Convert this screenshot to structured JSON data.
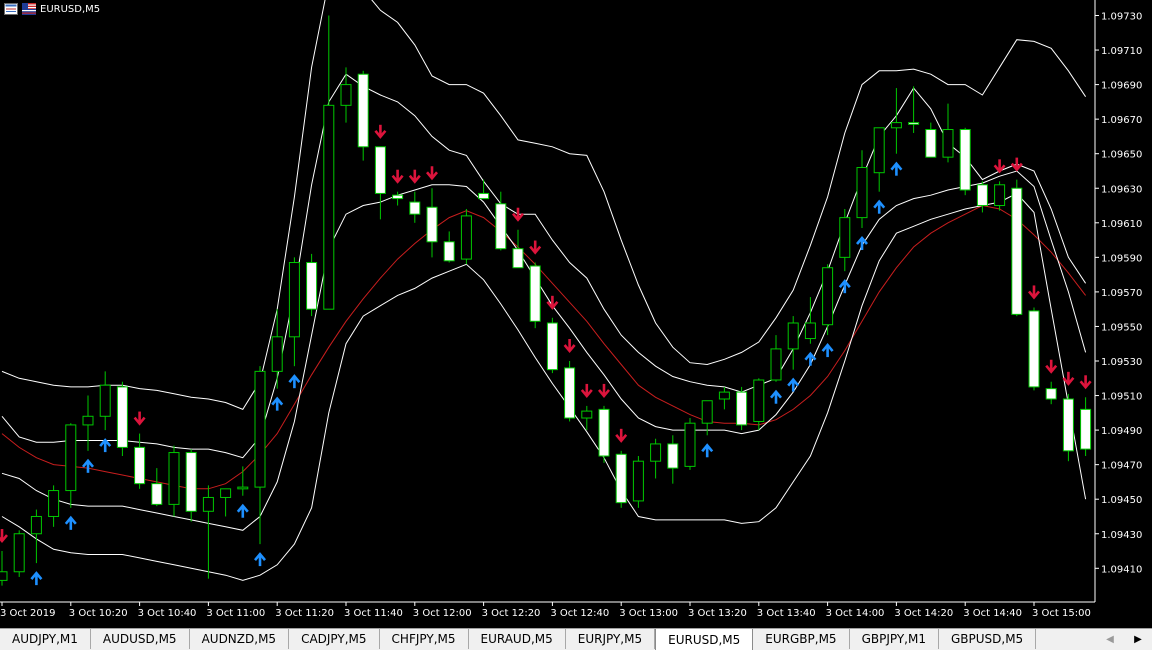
{
  "window": {
    "title": "EURUSD,M5"
  },
  "colors": {
    "background": "#000000",
    "bull_candle": "#00c800",
    "bear_candle_fill": "#ffffff",
    "bands": "#ffffff",
    "center_line": "#c81e1e",
    "up_arrow": "#1e90ff",
    "down_arrow": "#dc143c",
    "axis_text": "#ffffff"
  },
  "chart_data": {
    "type": "candlestick",
    "symbol": "EURUSD",
    "timeframe": "M5",
    "y_axis": {
      "labels": [
        "1.09730",
        "1.09710",
        "1.09690",
        "1.09670",
        "1.09650",
        "1.09630",
        "1.09610",
        "1.09590",
        "1.09570",
        "1.09550",
        "1.09530",
        "1.09510",
        "1.09490",
        "1.09470",
        "1.09450",
        "1.09430",
        "1.09410"
      ],
      "range": [
        1.09392,
        1.09742
      ]
    },
    "x_axis": {
      "labels": [
        "3 Oct 2019",
        "3 Oct 10:20",
        "3 Oct 10:40",
        "3 Oct 11:00",
        "3 Oct 11:20",
        "3 Oct 11:40",
        "3 Oct 12:00",
        "3 Oct 12:20",
        "3 Oct 12:40",
        "3 Oct 13:00",
        "3 Oct 13:20",
        "3 Oct 13:40",
        "3 Oct 14:00",
        "3 Oct 14:20",
        "3 Oct 14:40",
        "3 Oct 15:00"
      ]
    },
    "candles": [
      {
        "o": 1.09403,
        "h": 1.0942,
        "l": 1.094,
        "c": 1.09408
      },
      {
        "o": 1.09408,
        "h": 1.09432,
        "l": 1.09405,
        "c": 1.0943
      },
      {
        "o": 1.0943,
        "h": 1.09444,
        "l": 1.09413,
        "c": 1.0944
      },
      {
        "o": 1.0944,
        "h": 1.09458,
        "l": 1.09434,
        "c": 1.09455
      },
      {
        "o": 1.09455,
        "h": 1.09494,
        "l": 1.09445,
        "c": 1.09493
      },
      {
        "o": 1.09493,
        "h": 1.0951,
        "l": 1.09478,
        "c": 1.09498
      },
      {
        "o": 1.09498,
        "h": 1.09524,
        "l": 1.0949,
        "c": 1.09516
      },
      {
        "o": 1.09515,
        "h": 1.09518,
        "l": 1.09475,
        "c": 1.0948
      },
      {
        "o": 1.0948,
        "h": 1.09488,
        "l": 1.09456,
        "c": 1.09459
      },
      {
        "o": 1.09459,
        "h": 1.09468,
        "l": 1.09446,
        "c": 1.09447
      },
      {
        "o": 1.09447,
        "h": 1.09481,
        "l": 1.0944,
        "c": 1.09477
      },
      {
        "o": 1.09477,
        "h": 1.09479,
        "l": 1.09437,
        "c": 1.09443
      },
      {
        "o": 1.09443,
        "h": 1.09458,
        "l": 1.09404,
        "c": 1.09451
      },
      {
        "o": 1.09451,
        "h": 1.09455,
        "l": 1.0944,
        "c": 1.09456
      },
      {
        "o": 1.09456,
        "h": 1.09469,
        "l": 1.09452,
        "c": 1.09457
      },
      {
        "o": 1.09457,
        "h": 1.09527,
        "l": 1.09424,
        "c": 1.09524
      },
      {
        "o": 1.09524,
        "h": 1.0956,
        "l": 1.09514,
        "c": 1.09544
      },
      {
        "o": 1.09544,
        "h": 1.0959,
        "l": 1.09527,
        "c": 1.09587
      },
      {
        "o": 1.09587,
        "h": 1.09592,
        "l": 1.09556,
        "c": 1.0956
      },
      {
        "o": 1.0956,
        "h": 1.0973,
        "l": 1.0956,
        "c": 1.09678
      },
      {
        "o": 1.09678,
        "h": 1.097,
        "l": 1.09668,
        "c": 1.0969
      },
      {
        "o": 1.09696,
        "h": 1.09698,
        "l": 1.09646,
        "c": 1.09654
      },
      {
        "o": 1.09654,
        "h": 1.09654,
        "l": 1.09612,
        "c": 1.09627
      },
      {
        "o": 1.09626,
        "h": 1.09628,
        "l": 1.0962,
        "c": 1.09624
      },
      {
        "o": 1.09622,
        "h": 1.09628,
        "l": 1.0961,
        "c": 1.09615
      },
      {
        "o": 1.09619,
        "h": 1.0963,
        "l": 1.0959,
        "c": 1.09599
      },
      {
        "o": 1.09599,
        "h": 1.09605,
        "l": 1.09587,
        "c": 1.09588
      },
      {
        "o": 1.09589,
        "h": 1.09618,
        "l": 1.09586,
        "c": 1.09614
      },
      {
        "o": 1.09627,
        "h": 1.09635,
        "l": 1.09624,
        "c": 1.09624
      },
      {
        "o": 1.09621,
        "h": 1.09628,
        "l": 1.09594,
        "c": 1.09595
      },
      {
        "o": 1.09595,
        "h": 1.09606,
        "l": 1.09584,
        "c": 1.09584
      },
      {
        "o": 1.09585,
        "h": 1.09587,
        "l": 1.09549,
        "c": 1.09553
      },
      {
        "o": 1.09552,
        "h": 1.09555,
        "l": 1.09523,
        "c": 1.09525
      },
      {
        "o": 1.09526,
        "h": 1.0953,
        "l": 1.09495,
        "c": 1.09497
      },
      {
        "o": 1.09497,
        "h": 1.09504,
        "l": 1.0949,
        "c": 1.09501
      },
      {
        "o": 1.09502,
        "h": 1.09504,
        "l": 1.09471,
        "c": 1.09475
      },
      {
        "o": 1.09476,
        "h": 1.09478,
        "l": 1.09445,
        "c": 1.09448
      },
      {
        "o": 1.09449,
        "h": 1.09475,
        "l": 1.09445,
        "c": 1.09472
      },
      {
        "o": 1.09472,
        "h": 1.09485,
        "l": 1.09462,
        "c": 1.09482
      },
      {
        "o": 1.09482,
        "h": 1.09487,
        "l": 1.09459,
        "c": 1.09468
      },
      {
        "o": 1.09469,
        "h": 1.09497,
        "l": 1.09467,
        "c": 1.09494
      },
      {
        "o": 1.09494,
        "h": 1.09507,
        "l": 1.09487,
        "c": 1.09507
      },
      {
        "o": 1.09508,
        "h": 1.09515,
        "l": 1.09502,
        "c": 1.09512
      },
      {
        "o": 1.09512,
        "h": 1.09515,
        "l": 1.0949,
        "c": 1.09493
      },
      {
        "o": 1.09495,
        "h": 1.0952,
        "l": 1.0949,
        "c": 1.09519
      },
      {
        "o": 1.09519,
        "h": 1.09545,
        "l": 1.09518,
        "c": 1.09537
      },
      {
        "o": 1.09537,
        "h": 1.09556,
        "l": 1.09525,
        "c": 1.09552
      },
      {
        "o": 1.09543,
        "h": 1.09567,
        "l": 1.0954,
        "c": 1.09552
      },
      {
        "o": 1.09551,
        "h": 1.09586,
        "l": 1.09545,
        "c": 1.09584
      },
      {
        "o": 1.0959,
        "h": 1.09618,
        "l": 1.09582,
        "c": 1.09613
      },
      {
        "o": 1.09613,
        "h": 1.09652,
        "l": 1.09607,
        "c": 1.09642
      },
      {
        "o": 1.09639,
        "h": 1.09665,
        "l": 1.09628,
        "c": 1.09665
      },
      {
        "o": 1.09665,
        "h": 1.09688,
        "l": 1.0965,
        "c": 1.09668
      },
      {
        "o": 1.09668,
        "h": 1.09689,
        "l": 1.09662,
        "c": 1.09667
      },
      {
        "o": 1.09664,
        "h": 1.09668,
        "l": 1.09648,
        "c": 1.09648
      },
      {
        "o": 1.09648,
        "h": 1.09679,
        "l": 1.09645,
        "c": 1.09664
      },
      {
        "o": 1.09664,
        "h": 1.09665,
        "l": 1.09626,
        "c": 1.09629
      },
      {
        "o": 1.09632,
        "h": 1.09634,
        "l": 1.09616,
        "c": 1.0962
      },
      {
        "o": 1.0962,
        "h": 1.09634,
        "l": 1.09617,
        "c": 1.09632
      },
      {
        "o": 1.0963,
        "h": 1.09635,
        "l": 1.09556,
        "c": 1.09557
      },
      {
        "o": 1.09559,
        "h": 1.09561,
        "l": 1.09513,
        "c": 1.09515
      },
      {
        "o": 1.09514,
        "h": 1.09518,
        "l": 1.09505,
        "c": 1.09508
      },
      {
        "o": 1.09508,
        "h": 1.09511,
        "l": 1.09472,
        "c": 1.09478
      },
      {
        "o": 1.09502,
        "h": 1.09509,
        "l": 1.09475,
        "c": 1.09479
      }
    ],
    "indicators": {
      "upper_outer_band": [
        1.09524,
        1.0952,
        1.09518,
        1.09516,
        1.09515,
        1.09515,
        1.09516,
        1.09516,
        1.09514,
        1.09513,
        1.09511,
        1.09509,
        1.09508,
        1.09506,
        1.09502,
        1.09518,
        1.0956,
        1.09625,
        1.097,
        1.0975,
        1.0976,
        1.09745,
        1.09733,
        1.09726,
        1.09713,
        1.09695,
        1.0969,
        1.0969,
        1.09685,
        1.09672,
        1.09658,
        1.09656,
        1.09654,
        1.0965,
        1.09649,
        1.09628,
        1.096,
        1.09574,
        1.09552,
        1.09538,
        1.09529,
        1.09528,
        1.09531,
        1.09535,
        1.09541,
        1.09555,
        1.09571,
        1.09597,
        1.09625,
        1.09662,
        1.0969,
        1.09698,
        1.09698,
        1.09699,
        1.09696,
        1.0969,
        1.0969,
        1.09684,
        1.097,
        1.09716,
        1.09715,
        1.09711,
        1.09698,
        1.09683
      ],
      "upper_inner_band": [
        1.09498,
        1.09486,
        1.09483,
        1.09483,
        1.09484,
        1.09484,
        1.09484,
        1.09484,
        1.09483,
        1.09482,
        1.0948,
        1.09479,
        1.09479,
        1.09477,
        1.09474,
        1.09486,
        1.0952,
        1.0957,
        1.09632,
        1.0968,
        1.09696,
        1.09689,
        1.09684,
        1.0968,
        1.09672,
        1.0966,
        1.09652,
        1.09649,
        1.09634,
        1.09621,
        1.09615,
        1.09615,
        1.096,
        1.09587,
        1.09578,
        1.0956,
        1.09545,
        1.09535,
        1.09527,
        1.09521,
        1.09518,
        1.09516,
        1.09515,
        1.09512,
        1.09516,
        1.0952,
        1.09537,
        1.09558,
        1.09582,
        1.0961,
        1.09636,
        1.0966,
        1.09672,
        1.09688,
        1.09676,
        1.09656,
        1.09648,
        1.09635,
        1.0964,
        1.09644,
        1.0964,
        1.09618,
        1.0959,
        1.09575
      ],
      "center_line": [
        1.09488,
        1.0948,
        1.09474,
        1.0947,
        1.09469,
        1.09468,
        1.09466,
        1.09464,
        1.09462,
        1.0946,
        1.09458,
        1.09456,
        1.09456,
        1.09459,
        1.09466,
        1.09476,
        1.09488,
        1.09505,
        1.09522,
        1.09538,
        1.09553,
        1.09566,
        1.09578,
        1.09589,
        1.09598,
        1.09606,
        1.09613,
        1.09617,
        1.09613,
        1.09605,
        1.09596,
        1.09586,
        1.09575,
        1.09564,
        1.09553,
        1.0954,
        1.09528,
        1.09516,
        1.09509,
        1.09504,
        1.09499,
        1.09495,
        1.09494,
        1.09494,
        1.09493,
        1.09496,
        1.09502,
        1.0951,
        1.09521,
        1.09536,
        1.09553,
        1.0957,
        1.09584,
        1.09596,
        1.09604,
        1.0961,
        1.09615,
        1.0962,
        1.09618,
        1.09612,
        1.09603,
        1.09593,
        1.09581,
        1.09568
      ],
      "lower_inner_band": [
        1.09465,
        1.09462,
        1.09455,
        1.0945,
        1.09447,
        1.09446,
        1.09446,
        1.09446,
        1.09444,
        1.09442,
        1.0944,
        1.09438,
        1.09436,
        1.09434,
        1.09432,
        1.0944,
        1.0946,
        1.09495,
        1.09545,
        1.09595,
        1.09615,
        1.0962,
        1.09622,
        1.09626,
        1.09629,
        1.09632,
        1.09632,
        1.09631,
        1.09622,
        1.09608,
        1.09594,
        1.09578,
        1.09562,
        1.09549,
        1.09535,
        1.09522,
        1.09508,
        1.09497,
        1.09492,
        1.0949,
        1.0949,
        1.0949,
        1.0949,
        1.09488,
        1.0949,
        1.09499,
        1.09512,
        1.09528,
        1.0955,
        1.09574,
        1.09597,
        1.09612,
        1.0962,
        1.09624,
        1.09626,
        1.09629,
        1.09631,
        1.09633,
        1.09637,
        1.0964,
        1.09631,
        1.096,
        1.0957,
        1.09535
      ],
      "lower_outer_band": [
        1.0944,
        1.09434,
        1.09427,
        1.09421,
        1.09419,
        1.09418,
        1.09418,
        1.09418,
        1.09416,
        1.09414,
        1.09412,
        1.0941,
        1.09408,
        1.09406,
        1.09403,
        1.09406,
        1.09412,
        1.09424,
        1.09445,
        1.095,
        1.0954,
        1.09556,
        1.09562,
        1.09568,
        1.09572,
        1.09578,
        1.09582,
        1.09586,
        1.09577,
        1.09563,
        1.09548,
        1.09532,
        1.09517,
        1.09503,
        1.09489,
        1.09474,
        1.09455,
        1.0944,
        1.09438,
        1.09438,
        1.09438,
        1.09438,
        1.09438,
        1.09436,
        1.09437,
        1.09445,
        1.0946,
        1.09475,
        1.095,
        1.0953,
        1.09562,
        1.09588,
        1.09604,
        1.09608,
        1.09612,
        1.09615,
        1.09618,
        1.0962,
        1.09622,
        1.09627,
        1.09616,
        1.0956,
        1.09505,
        1.0945
      ]
    },
    "signals": {
      "up_indices": [
        2,
        4,
        5,
        6,
        14,
        15,
        16,
        17,
        41,
        45,
        46,
        47,
        48,
        49,
        50,
        51,
        52
      ],
      "down_indices": [
        0,
        8,
        22,
        23,
        24,
        25,
        30,
        31,
        32,
        33,
        34,
        35,
        36,
        58,
        59,
        60,
        61,
        62,
        63
      ]
    }
  },
  "tabs": [
    {
      "label": "AUDJPY,M1",
      "active": false
    },
    {
      "label": "AUDUSD,M5",
      "active": false
    },
    {
      "label": "AUDNZD,M5",
      "active": false
    },
    {
      "label": "CADJPY,M5",
      "active": false
    },
    {
      "label": "CHFJPY,M5",
      "active": false
    },
    {
      "label": "EURAUD,M5",
      "active": false
    },
    {
      "label": "EURJPY,M5",
      "active": false
    },
    {
      "label": "EURUSD,M5",
      "active": true
    },
    {
      "label": "EURGBP,M5",
      "active": false
    },
    {
      "label": "GBPJPY,M1",
      "active": false
    },
    {
      "label": "GBPUSD,M5",
      "active": false
    }
  ],
  "tab_scroll": {
    "left_icon": "chevron-left-icon",
    "right_icon": "chevron-right-icon",
    "left_glyph": "◀",
    "right_glyph": "▶"
  }
}
